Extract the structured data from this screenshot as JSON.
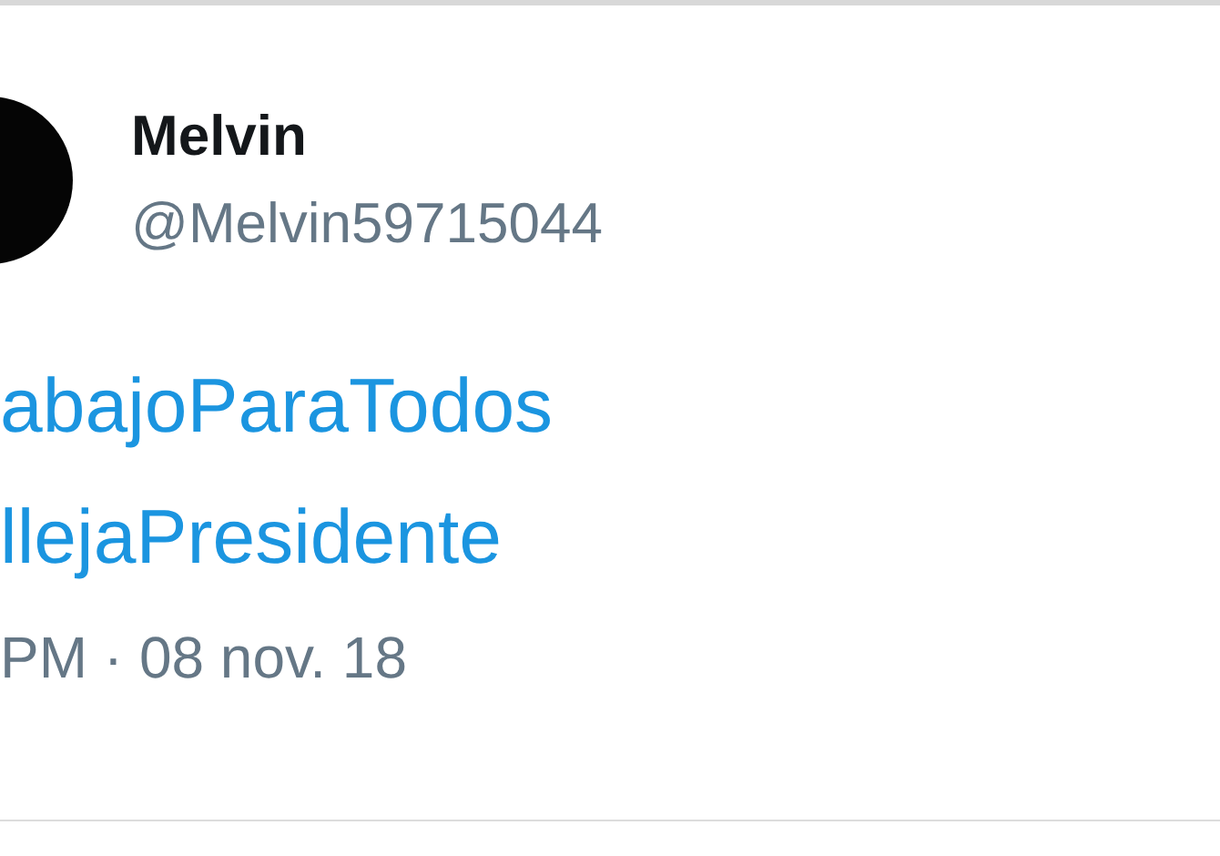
{
  "author": {
    "name": "Melvin",
    "handle": "@Melvin59715044"
  },
  "hashtags": [
    "abajoParaTodos",
    "llejaPresidente"
  ],
  "timestamp": "PM · 08 nov. 18"
}
